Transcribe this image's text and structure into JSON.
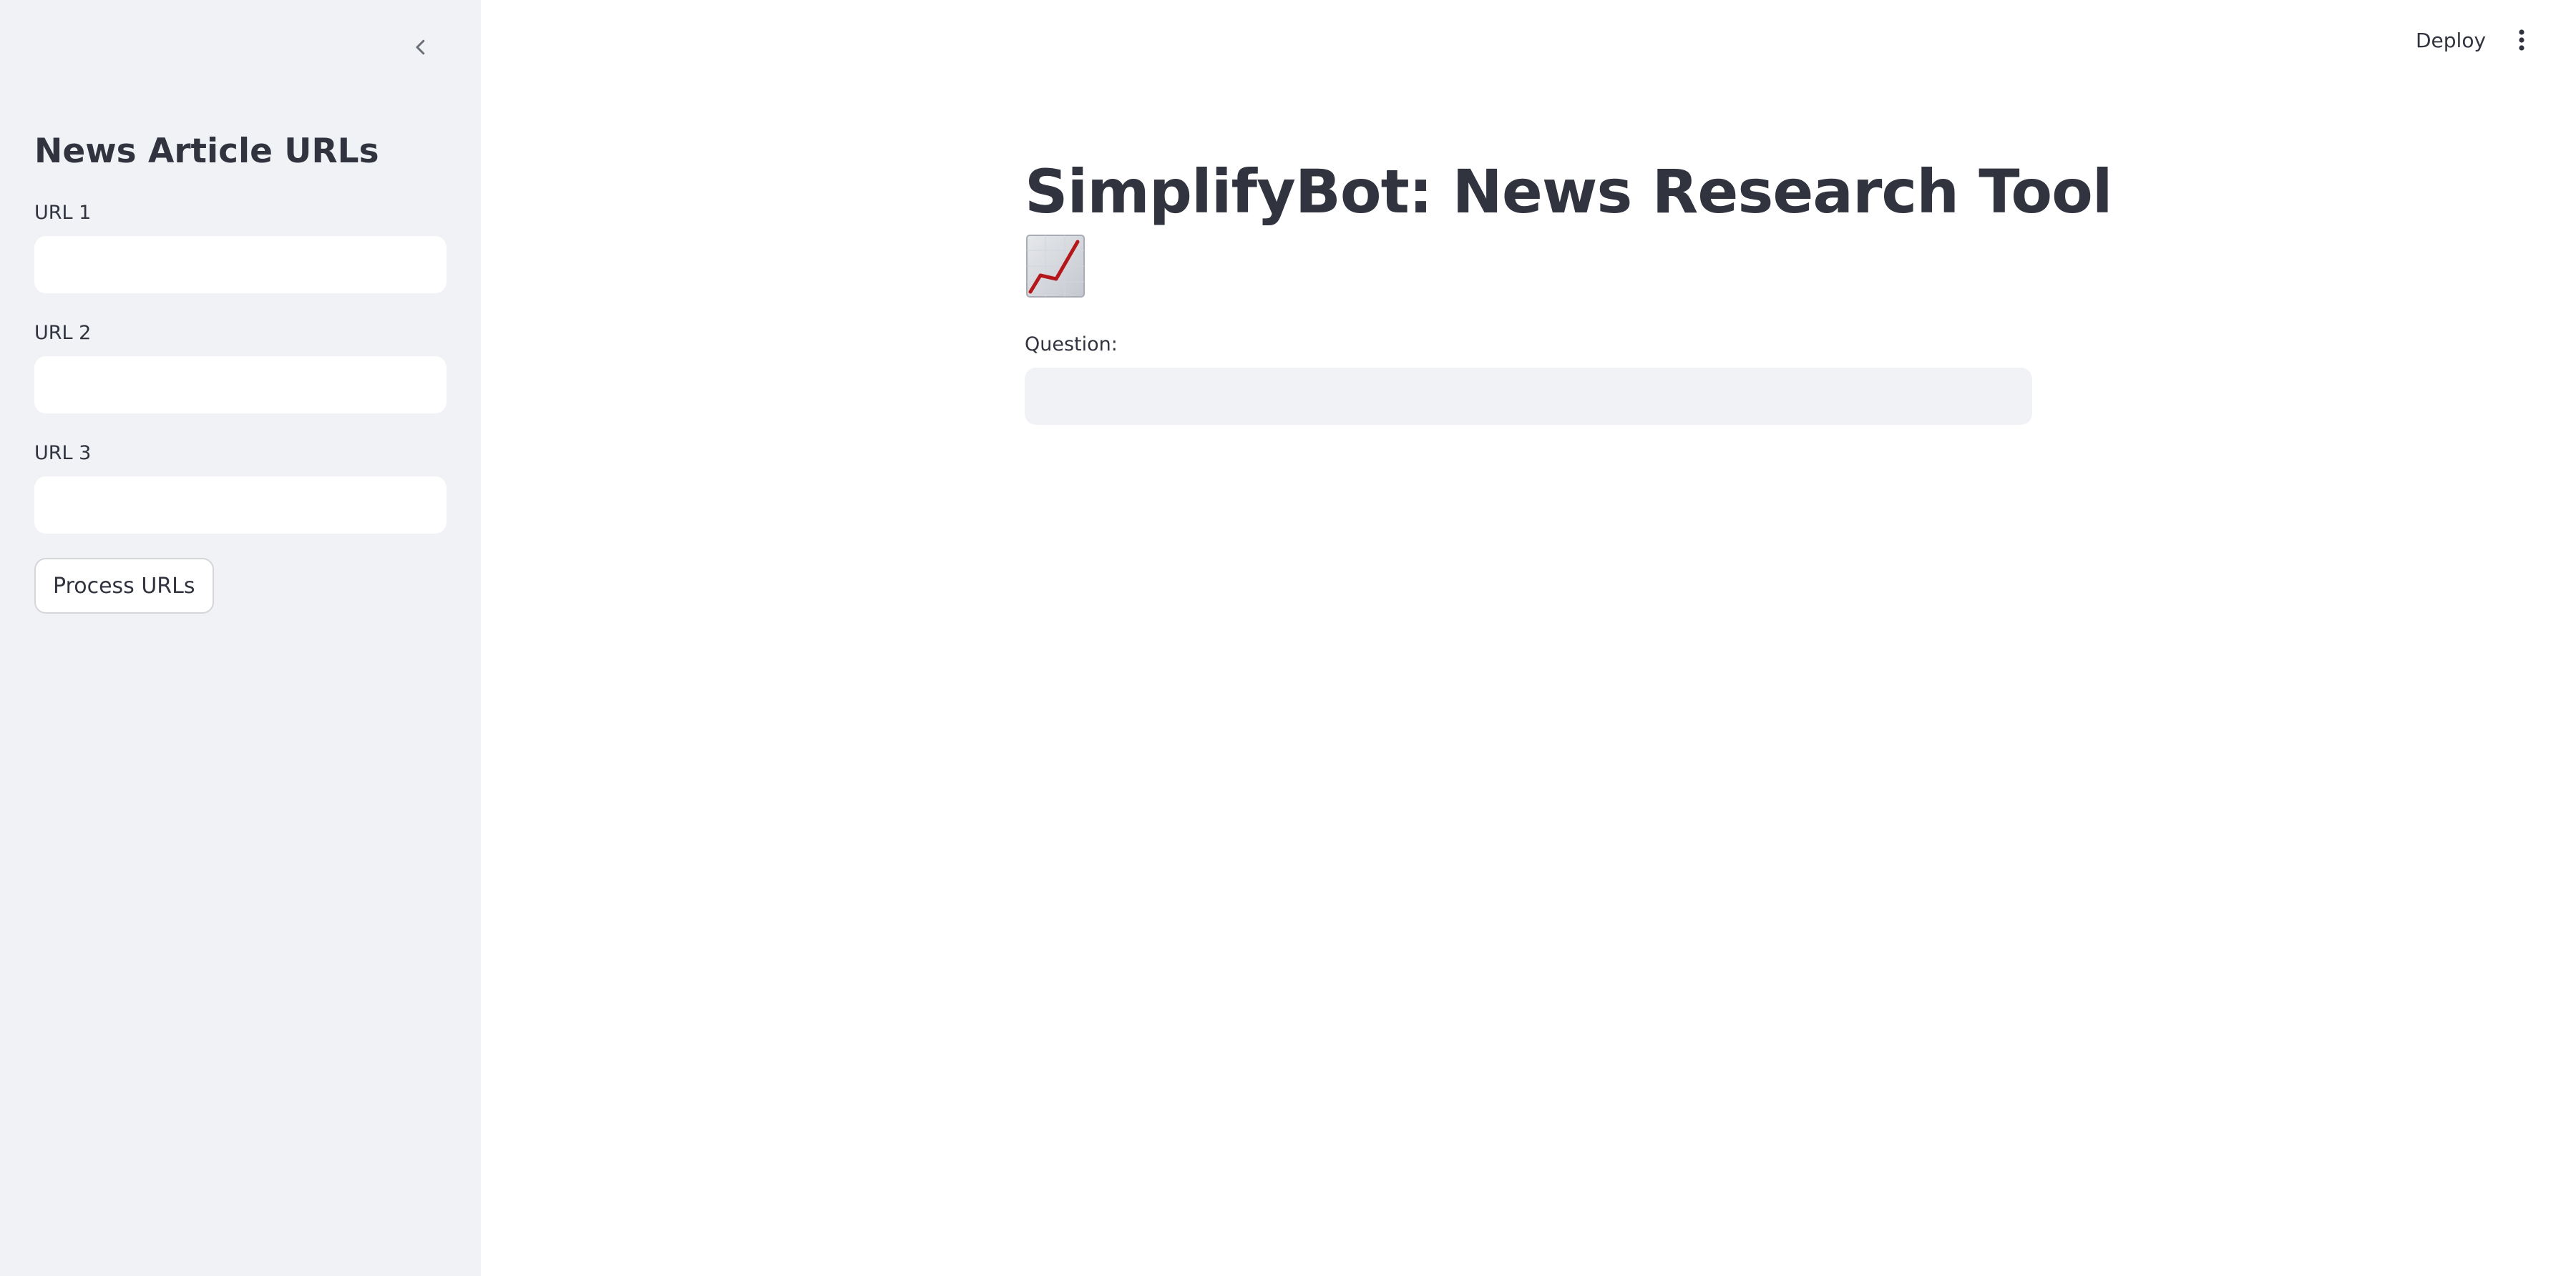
{
  "sidebar": {
    "collapse_icon": "chevron-left-icon",
    "title": "News Article URLs",
    "fields": [
      {
        "label": "URL 1",
        "value": ""
      },
      {
        "label": "URL 2",
        "value": ""
      },
      {
        "label": "URL 3",
        "value": ""
      }
    ],
    "process_button_label": "Process URLs"
  },
  "header": {
    "deploy_label": "Deploy",
    "menu_icon": "vertical-ellipsis-icon"
  },
  "main": {
    "title": "SimplifyBot: News Research Tool",
    "title_icon": "chart-increasing-emoji",
    "question_label": "Question:",
    "question_value": ""
  },
  "colors": {
    "sidebar_bg": "#f0f2f6",
    "text": "#31333f",
    "input_bg_main": "#f0f2f6",
    "input_bg_sidebar": "#ffffff"
  }
}
